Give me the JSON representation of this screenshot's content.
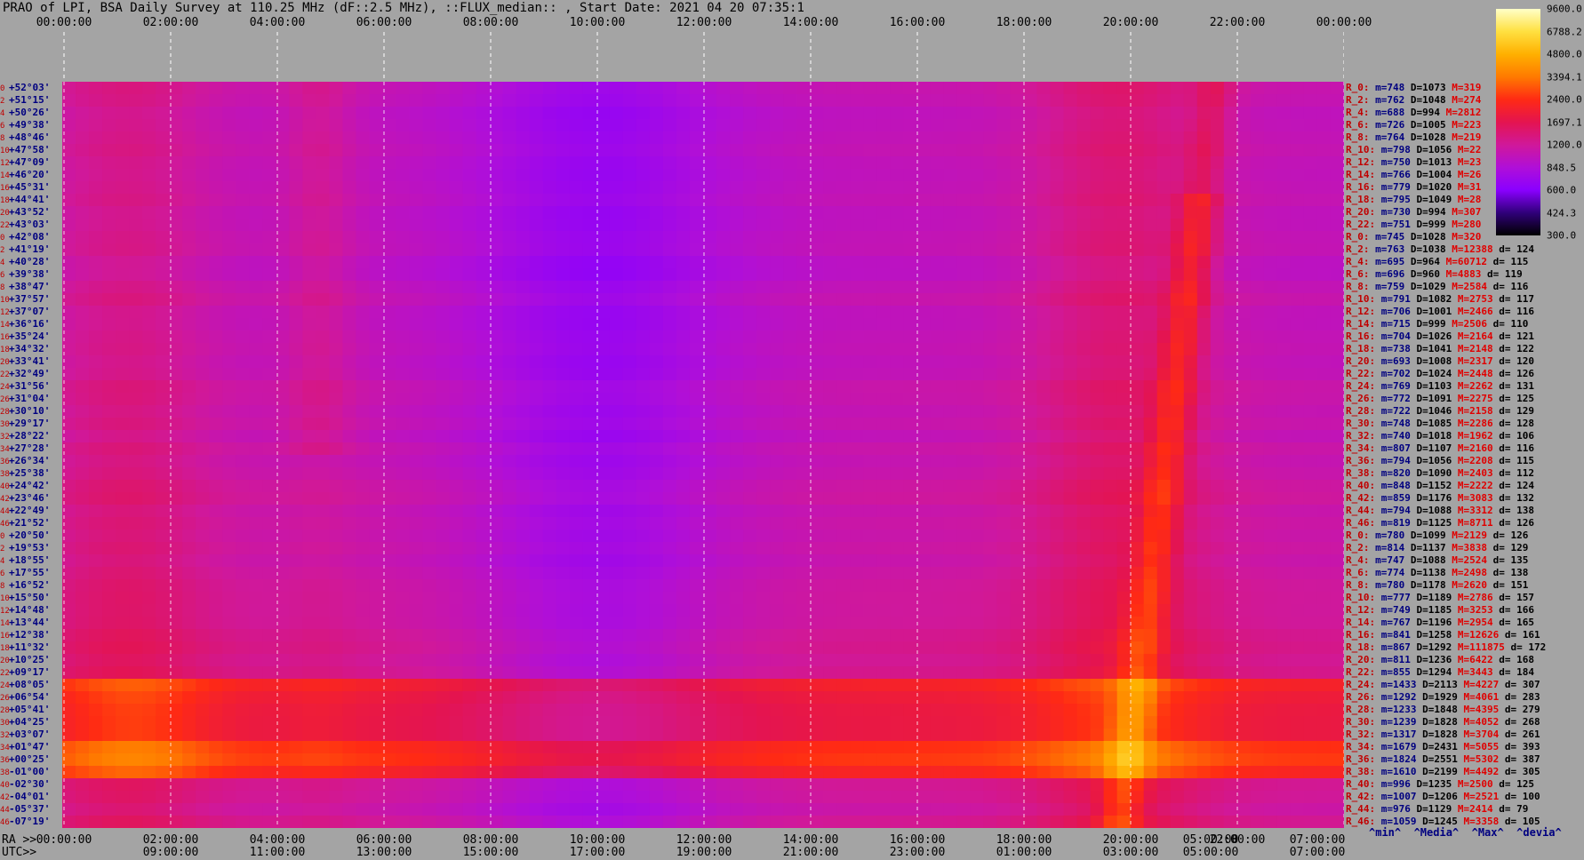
{
  "title": "PRAO of LPI, BSA Daily Survey at 110.25 MHz (dF::2.5 MHz), ::FLUX_median:: , Start Date: 2021 04 20 07:35:1",
  "top_ticks": [
    "00:00:00",
    "02:00:00",
    "04:00:00",
    "06:00:00",
    "08:00:00",
    "10:00:00",
    "12:00:00",
    "14:00:00",
    "16:00:00",
    "18:00:00",
    "20:00:00",
    "22:00:00",
    "00:00:00"
  ],
  "ra_label": "RA >>",
  "ra_ticks": [
    "00:00:00",
    "02:00:00",
    "04:00:00",
    "06:00:00",
    "08:00:00",
    "10:00:00",
    "12:00:00",
    "14:00:00",
    "16:00:00",
    "18:00:00",
    "20:00:00",
    "05:00:00",
    "22:00:00",
    "07:00:00"
  ],
  "utc_label": "UTC>>",
  "utc_ticks": [
    "09:00:00",
    "11:00:00",
    "13:00:00",
    "15:00:00",
    "17:00:00",
    "19:00:00",
    "21:00:00",
    "23:00:00",
    "01:00:00",
    "03:00:00",
    "05:00:00",
    "07:00:00"
  ],
  "dec_labels": [
    {
      "i": "0",
      "d": "+52°03'"
    },
    {
      "i": "2",
      "d": "+51°15'"
    },
    {
      "i": "4",
      "d": "+50°26'"
    },
    {
      "i": "6",
      "d": "+49°38'"
    },
    {
      "i": "8",
      "d": "+48°46'"
    },
    {
      "i": "10",
      "d": "+47°58'"
    },
    {
      "i": "12",
      "d": "+47°09'"
    },
    {
      "i": "14",
      "d": "+46°20'"
    },
    {
      "i": "16",
      "d": "+45°31'"
    },
    {
      "i": "18",
      "d": "+44°41'"
    },
    {
      "i": "20",
      "d": "+43°52'"
    },
    {
      "i": "22",
      "d": "+43°03'"
    },
    {
      "i": "0",
      "d": "+42°08'"
    },
    {
      "i": "2",
      "d": "+41°19'"
    },
    {
      "i": "4",
      "d": "+40°28'"
    },
    {
      "i": "6",
      "d": "+39°38'"
    },
    {
      "i": "8",
      "d": "+38°47'"
    },
    {
      "i": "10",
      "d": "+37°57'"
    },
    {
      "i": "12",
      "d": "+37°07'"
    },
    {
      "i": "14",
      "d": "+36°16'"
    },
    {
      "i": "16",
      "d": "+35°24'"
    },
    {
      "i": "18",
      "d": "+34°32'"
    },
    {
      "i": "20",
      "d": "+33°41'"
    },
    {
      "i": "22",
      "d": "+32°49'"
    },
    {
      "i": "24",
      "d": "+31°56'"
    },
    {
      "i": "26",
      "d": "+31°04'"
    },
    {
      "i": "28",
      "d": "+30°10'"
    },
    {
      "i": "30",
      "d": "+29°17'"
    },
    {
      "i": "32",
      "d": "+28°22'"
    },
    {
      "i": "34",
      "d": "+27°28'"
    },
    {
      "i": "36",
      "d": "+26°34'"
    },
    {
      "i": "38",
      "d": "+25°38'"
    },
    {
      "i": "40",
      "d": "+24°42'"
    },
    {
      "i": "42",
      "d": "+23°46'"
    },
    {
      "i": "44",
      "d": "+22°49'"
    },
    {
      "i": "46",
      "d": "+21°52'"
    },
    {
      "i": "0",
      "d": "+20°50'"
    },
    {
      "i": "2",
      "d": "+19°53'"
    },
    {
      "i": "4",
      "d": "+18°55'"
    },
    {
      "i": "6",
      "d": "+17°55'"
    },
    {
      "i": "8",
      "d": "+16°52'"
    },
    {
      "i": "10",
      "d": "+15°50'"
    },
    {
      "i": "12",
      "d": "+14°48'"
    },
    {
      "i": "14",
      "d": "+13°44'"
    },
    {
      "i": "16",
      "d": "+12°38'"
    },
    {
      "i": "18",
      "d": "+11°32'"
    },
    {
      "i": "20",
      "d": "+10°25'"
    },
    {
      "i": "22",
      "d": "+09°17'"
    },
    {
      "i": "24",
      "d": "+08°05'"
    },
    {
      "i": "26",
      "d": "+06°54'"
    },
    {
      "i": "28",
      "d": "+05°41'"
    },
    {
      "i": "30",
      "d": "+04°25'"
    },
    {
      "i": "32",
      "d": "+03°07'"
    },
    {
      "i": "34",
      "d": "+01°47'"
    },
    {
      "i": "36",
      "d": "+00°25'"
    },
    {
      "i": "38",
      "d": "-01°00'"
    },
    {
      "i": "40",
      "d": "-02°30'"
    },
    {
      "i": "42",
      "d": "-04°01'"
    },
    {
      "i": "44",
      "d": "-05°37'"
    },
    {
      "i": "46",
      "d": "-07°19'"
    }
  ],
  "stats": [
    {
      "r": "R_0:",
      "m": "m=748",
      "D": "D=1073",
      "M": "M=319",
      "d": ""
    },
    {
      "r": "R_2:",
      "m": "m=762",
      "D": "D=1048",
      "M": "M=274",
      "d": ""
    },
    {
      "r": "R_4:",
      "m": "m=688",
      "D": "D=994",
      "M": "M=2812",
      "d": ""
    },
    {
      "r": "R_6:",
      "m": "m=726",
      "D": "D=1005",
      "M": "M=223",
      "d": ""
    },
    {
      "r": "R_8:",
      "m": "m=764",
      "D": "D=1028",
      "M": "M=219",
      "d": ""
    },
    {
      "r": "R_10:",
      "m": "m=798",
      "D": "D=1056",
      "M": "M=22",
      "d": ""
    },
    {
      "r": "R_12:",
      "m": "m=750",
      "D": "D=1013",
      "M": "M=23",
      "d": ""
    },
    {
      "r": "R_14:",
      "m": "m=766",
      "D": "D=1004",
      "M": "M=26",
      "d": ""
    },
    {
      "r": "R_16:",
      "m": "m=779",
      "D": "D=1020",
      "M": "M=31",
      "d": ""
    },
    {
      "r": "R_18:",
      "m": "m=795",
      "D": "D=1049",
      "M": "M=28",
      "d": ""
    },
    {
      "r": "R_20:",
      "m": "m=730",
      "D": "D=994",
      "M": "M=307",
      "d": ""
    },
    {
      "r": "R_22:",
      "m": "m=751",
      "D": "D=999",
      "M": "M=280",
      "d": ""
    },
    {
      "r": "R_0:",
      "m": "m=745",
      "D": "D=1028",
      "M": "M=320",
      "d": ""
    },
    {
      "r": "R_2:",
      "m": "m=763",
      "D": "D=1038",
      "M": "M=12388",
      "d": "d= 124"
    },
    {
      "r": "R_4:",
      "m": "m=695",
      "D": "D=964",
      "M": "M=60712",
      "d": "d= 115"
    },
    {
      "r": "R_6:",
      "m": "m=696",
      "D": "D=960",
      "M": "M=4883",
      "d": "d= 119"
    },
    {
      "r": "R_8:",
      "m": "m=759",
      "D": "D=1029",
      "M": "M=2584",
      "d": "d= 116"
    },
    {
      "r": "R_10:",
      "m": "m=791",
      "D": "D=1082",
      "M": "M=2753",
      "d": "d= 117"
    },
    {
      "r": "R_12:",
      "m": "m=706",
      "D": "D=1001",
      "M": "M=2466",
      "d": "d= 116"
    },
    {
      "r": "R_14:",
      "m": "m=715",
      "D": "D=999",
      "M": "M=2506",
      "d": "d= 110"
    },
    {
      "r": "R_16:",
      "m": "m=704",
      "D": "D=1026",
      "M": "M=2164",
      "d": "d= 121"
    },
    {
      "r": "R_18:",
      "m": "m=738",
      "D": "D=1041",
      "M": "M=2148",
      "d": "d= 122"
    },
    {
      "r": "R_20:",
      "m": "m=693",
      "D": "D=1008",
      "M": "M=2317",
      "d": "d= 120"
    },
    {
      "r": "R_22:",
      "m": "m=702",
      "D": "D=1024",
      "M": "M=2448",
      "d": "d= 126"
    },
    {
      "r": "R_24:",
      "m": "m=769",
      "D": "D=1103",
      "M": "M=2262",
      "d": "d= 131"
    },
    {
      "r": "R_26:",
      "m": "m=772",
      "D": "D=1091",
      "M": "M=2275",
      "d": "d= 125"
    },
    {
      "r": "R_28:",
      "m": "m=722",
      "D": "D=1046",
      "M": "M=2158",
      "d": "d= 129"
    },
    {
      "r": "R_30:",
      "m": "m=748",
      "D": "D=1085",
      "M": "M=2286",
      "d": "d= 128"
    },
    {
      "r": "R_32:",
      "m": "m=740",
      "D": "D=1018",
      "M": "M=1962",
      "d": "d= 106"
    },
    {
      "r": "R_34:",
      "m": "m=807",
      "D": "D=1107",
      "M": "M=2160",
      "d": "d= 116"
    },
    {
      "r": "R_36:",
      "m": "m=794",
      "D": "D=1056",
      "M": "M=2208",
      "d": "d= 115"
    },
    {
      "r": "R_38:",
      "m": "m=820",
      "D": "D=1090",
      "M": "M=2403",
      "d": "d= 112"
    },
    {
      "r": "R_40:",
      "m": "m=848",
      "D": "D=1152",
      "M": "M=2222",
      "d": "d= 124"
    },
    {
      "r": "R_42:",
      "m": "m=859",
      "D": "D=1176",
      "M": "M=3083",
      "d": "d= 132"
    },
    {
      "r": "R_44:",
      "m": "m=794",
      "D": "D=1088",
      "M": "M=3312",
      "d": "d= 138"
    },
    {
      "r": "R_46:",
      "m": "m=819",
      "D": "D=1125",
      "M": "M=8711",
      "d": "d= 126"
    },
    {
      "r": "R_0:",
      "m": "m=780",
      "D": "D=1099",
      "M": "M=2129",
      "d": "d= 126"
    },
    {
      "r": "R_2:",
      "m": "m=814",
      "D": "D=1137",
      "M": "M=3838",
      "d": "d= 129"
    },
    {
      "r": "R_4:",
      "m": "m=747",
      "D": "D=1088",
      "M": "M=2524",
      "d": "d= 135"
    },
    {
      "r": "R_6:",
      "m": "m=774",
      "D": "D=1138",
      "M": "M=2498",
      "d": "d= 138"
    },
    {
      "r": "R_8:",
      "m": "m=780",
      "D": "D=1178",
      "M": "M=2620",
      "d": "d= 151"
    },
    {
      "r": "R_10:",
      "m": "m=777",
      "D": "D=1189",
      "M": "M=2786",
      "d": "d= 157"
    },
    {
      "r": "R_12:",
      "m": "m=749",
      "D": "D=1185",
      "M": "M=3253",
      "d": "d= 166"
    },
    {
      "r": "R_14:",
      "m": "m=767",
      "D": "D=1196",
      "M": "M=2954",
      "d": "d= 165"
    },
    {
      "r": "R_16:",
      "m": "m=841",
      "D": "D=1258",
      "M": "M=12626",
      "d": "d= 161"
    },
    {
      "r": "R_18:",
      "m": "m=867",
      "D": "D=1292",
      "M": "M=111875",
      "d": "d= 172"
    },
    {
      "r": "R_20:",
      "m": "m=811",
      "D": "D=1236",
      "M": "M=6422",
      "d": "d= 168"
    },
    {
      "r": "R_22:",
      "m": "m=855",
      "D": "D=1294",
      "M": "M=3443",
      "d": "d= 184"
    },
    {
      "r": "R_24:",
      "m": "m=1433",
      "D": "D=2113",
      "M": "M=4227",
      "d": "d= 307"
    },
    {
      "r": "R_26:",
      "m": "m=1292",
      "D": "D=1929",
      "M": "M=4061",
      "d": "d= 283"
    },
    {
      "r": "R_28:",
      "m": "m=1233",
      "D": "D=1848",
      "M": "M=4395",
      "d": "d= 279"
    },
    {
      "r": "R_30:",
      "m": "m=1239",
      "D": "D=1828",
      "M": "M=4052",
      "d": "d= 268"
    },
    {
      "r": "R_32:",
      "m": "m=1317",
      "D": "D=1828",
      "M": "M=3704",
      "d": "d= 261"
    },
    {
      "r": "R_34:",
      "m": "m=1679",
      "D": "D=2431",
      "M": "M=5055",
      "d": "d= 393"
    },
    {
      "r": "R_36:",
      "m": "m=1824",
      "D": "D=2551",
      "M": "M=5302",
      "d": "d= 387"
    },
    {
      "r": "R_38:",
      "m": "m=1610",
      "D": "D=2199",
      "M": "M=4492",
      "d": "d= 305"
    },
    {
      "r": "R_40:",
      "m": "m=996",
      "D": "D=1235",
      "M": "M=2500",
      "d": "d= 125"
    },
    {
      "r": "R_42:",
      "m": "m=1007",
      "D": "D=1206",
      "M": "M=2521",
      "d": "d= 100"
    },
    {
      "r": "R_44:",
      "m": "m=976",
      "D": "D=1129",
      "M": "M=2414",
      "d": "d= 79"
    },
    {
      "r": "R_46:",
      "m": "m=1059",
      "D": "D=1245",
      "M": "M=3358",
      "d": "d= 105"
    }
  ],
  "stats_legend": "^min^  ^Media^  ^Max^  ^devia^",
  "colorbar_labels": [
    "9600.0",
    "6788.2",
    "4800.0",
    "3394.1",
    "2400.0",
    "1697.1",
    "1200.0",
    "848.5",
    "600.0",
    "424.3",
    "300.0"
  ],
  "colors": {
    "c0": "#000000",
    "c1": "#30007a",
    "c2": "#8a00ff",
    "c3": "#b00fd8",
    "c4": "#d0189a",
    "c5": "#e41450",
    "c6": "#ff2a14",
    "c7": "#ff7a00",
    "c8": "#ffb000",
    "c9": "#ffe040",
    "c10": "#ffffc8"
  },
  "chart_data": {
    "type": "heatmap",
    "title": "PRAO of LPI, BSA Daily Survey at 110.25 MHz (dF::2.5 MHz), ::FLUX_median:: , Start Date: 2021 04 20 07:35:1",
    "xlabel": "RA",
    "ylabel": "",
    "x_range_hours": [
      0,
      24
    ],
    "rows": 60,
    "colorbar_range": [
      300.0,
      9600.0
    ],
    "colorbar_scale": "log",
    "row_median_D": [
      1073,
      1048,
      994,
      1005,
      1028,
      1056,
      1013,
      1004,
      1020,
      1049,
      994,
      999,
      1028,
      1038,
      964,
      960,
      1029,
      1082,
      1001,
      999,
      1026,
      1041,
      1008,
      1024,
      1103,
      1091,
      1046,
      1085,
      1018,
      1107,
      1056,
      1090,
      1152,
      1176,
      1088,
      1125,
      1099,
      1137,
      1088,
      1138,
      1178,
      1189,
      1185,
      1196,
      1258,
      1292,
      1236,
      1294,
      2113,
      1929,
      1848,
      1828,
      1828,
      2431,
      2551,
      2199,
      1235,
      1206,
      1129,
      1245
    ],
    "row_min_m": [
      748,
      762,
      688,
      726,
      764,
      798,
      750,
      766,
      779,
      795,
      730,
      751,
      745,
      763,
      695,
      696,
      759,
      791,
      706,
      715,
      704,
      738,
      693,
      702,
      769,
      772,
      722,
      748,
      740,
      807,
      794,
      820,
      848,
      859,
      794,
      819,
      780,
      814,
      747,
      774,
      780,
      777,
      749,
      767,
      841,
      867,
      811,
      855,
      1433,
      1292,
      1233,
      1239,
      1317,
      1679,
      1824,
      1610,
      996,
      1007,
      976,
      1059
    ]
  }
}
